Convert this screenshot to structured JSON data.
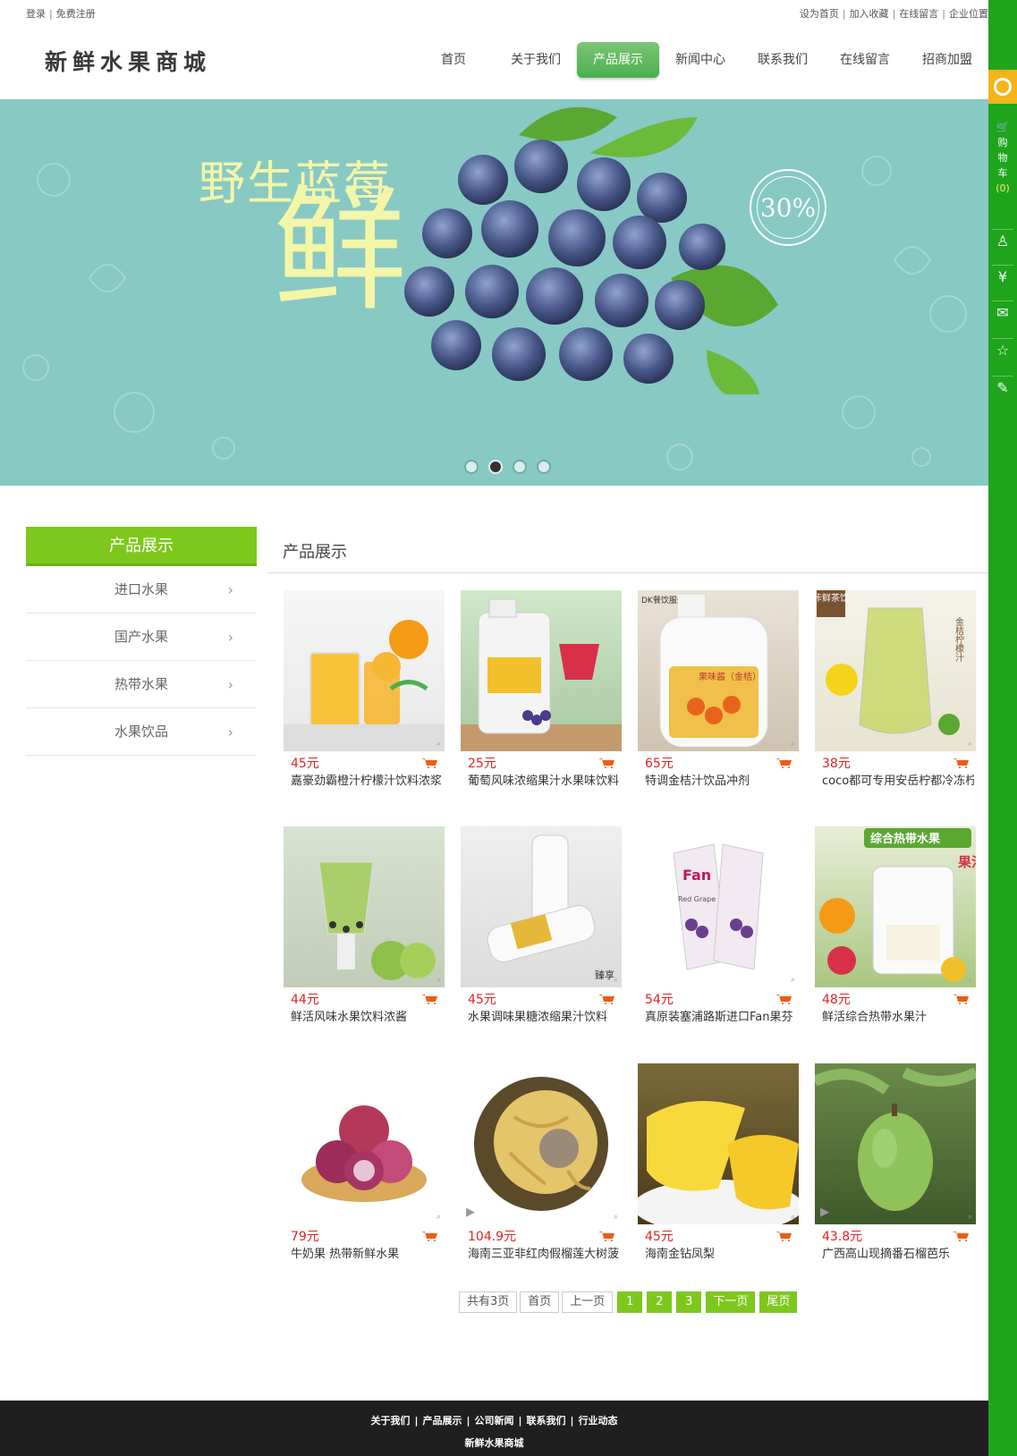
{
  "topbar": {
    "login": "登录",
    "register": "免费注册",
    "set_home": "设为首页",
    "favorite": "加入收藏",
    "message": "在线留言",
    "location": "企业位置"
  },
  "site_title": "新鲜水果商城",
  "nav": [
    {
      "label": "首页",
      "active": false
    },
    {
      "label": "关于我们",
      "active": false
    },
    {
      "label": "产品展示",
      "active": true
    },
    {
      "label": "新闻中心",
      "active": false
    },
    {
      "label": "联系我们",
      "active": false
    },
    {
      "label": "在线留言",
      "active": false
    },
    {
      "label": "招商加盟",
      "active": false
    }
  ],
  "banner": {
    "headline": "野生蓝莓",
    "big_char": "鲜",
    "discount": "30%",
    "slides": 4,
    "active_slide": 2
  },
  "sidebar": {
    "title": "产品展示",
    "categories": [
      "进口水果",
      "国产水果",
      "热带水果",
      "水果饮品"
    ]
  },
  "main": {
    "title": "产品展示",
    "products": [
      {
        "price": "45元",
        "name": "嘉豪劲霸橙汁柠檬汁饮料浓浆"
      },
      {
        "price": "25元",
        "name": "葡萄风味浓缩果汁水果味饮料"
      },
      {
        "price": "65元",
        "name": "特调金桔汁饮品冲剂"
      },
      {
        "price": "38元",
        "name": "coco都可专用安岳柠都冷冻柠"
      },
      {
        "price": "44元",
        "name": "鲜活风味水果饮料浓酱"
      },
      {
        "price": "45元",
        "name": "水果调味果糖浓缩果汁饮料"
      },
      {
        "price": "54元",
        "name": "真原装塞浦路斯进口Fan果芬"
      },
      {
        "price": "48元",
        "name": "鲜活综合热带水果汁"
      },
      {
        "price": "79元",
        "name": "牛奶果 热带新鲜水果"
      },
      {
        "price": "104.9元",
        "name": "海南三亚非红肉假榴莲大树菠"
      },
      {
        "price": "45元",
        "name": "海南金钻凤梨"
      },
      {
        "price": "43.8元",
        "name": "广西高山现摘番石榴芭乐"
      }
    ],
    "image_text": {
      "p3_brand": "DK餐饮服务",
      "p3_label": "果味酱（金桔）",
      "p4_tag": "佧鲜茶饮",
      "p4_vertical": "金桔柠檬汁",
      "p6_mark": "臻享",
      "p7_brand": "Fan",
      "p7_variant": "Red Grape",
      "p8_banner": "综合热带水果",
      "p8_char": "果汁"
    }
  },
  "pager": {
    "total": "共有3页",
    "first": "首页",
    "prev": "上一页",
    "pages": [
      "1",
      "2",
      "3"
    ],
    "next": "下一页",
    "last": "尾页"
  },
  "footer": {
    "links": [
      "关于我们",
      "产品展示",
      "公司新闻",
      "联系我们",
      "行业动态"
    ],
    "copyright": "新鲜水果商城"
  },
  "right_bar": {
    "cart_label": [
      "购",
      "物",
      "车"
    ],
    "cart_count": "(0)",
    "icons": [
      "headset-icon",
      "cart-icon",
      "user-icon",
      "yen-icon",
      "mail-icon",
      "star-icon",
      "edit-icon"
    ]
  },
  "colors": {
    "accent_green": "#7ec81e",
    "nav_active": "#5cb85c",
    "banner_bg": "#88c9c4",
    "price_red": "#e02222",
    "rightbar_green": "#1fa51c",
    "footer_bg": "#1f1f1f"
  }
}
